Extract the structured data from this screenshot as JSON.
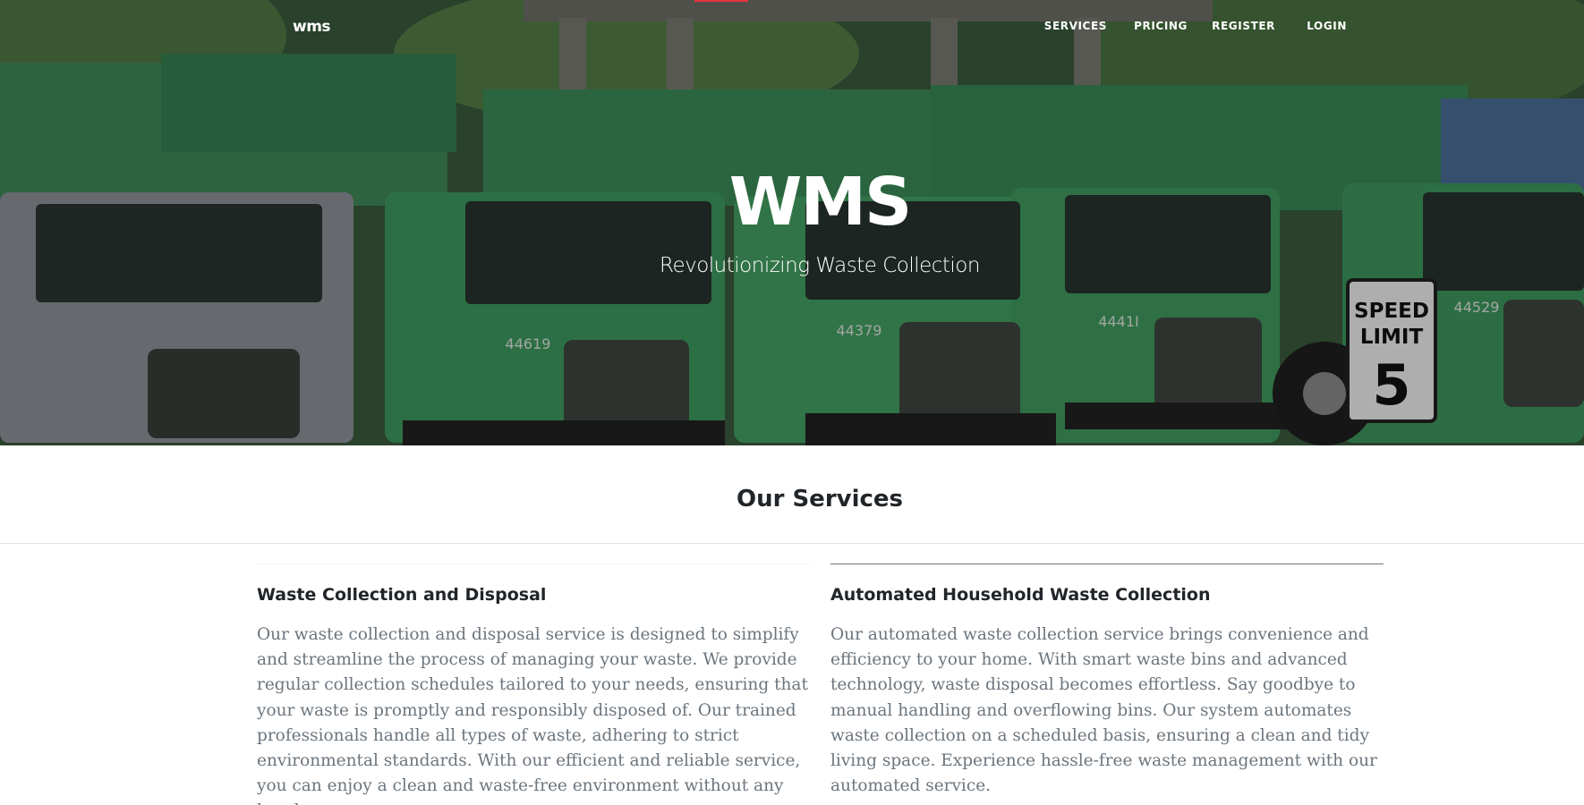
{
  "nav": {
    "brand": "wms",
    "links": [
      "SERVICES",
      "PRICING",
      "REGISTER",
      "LOGIN"
    ]
  },
  "hero": {
    "title": "WMS",
    "subtitle": "Revolutionizing Waste Collection"
  },
  "services": {
    "heading": "Our Services",
    "items": [
      {
        "title": "Waste Collection and Disposal",
        "body": "Our waste collection and disposal service is designed to simplify and streamline the process of managing your waste. We provide regular collection schedules tailored to your needs, ensuring that your waste is promptly and responsibly disposed of. Our trained professionals handle all types of waste, adhering to strict environmental standards. With our efficient and reliable service, you can enjoy a clean and waste-free environment without any hassle."
      },
      {
        "title": "Automated Household Waste Collection",
        "body": "Our automated waste collection service brings convenience and efficiency to your home. With smart waste bins and advanced technology, waste disposal becomes effortless. Say goodbye to manual handling and overflowing bins. Our system automates waste collection on a scheduled basis, ensuring a clean and tidy living space. Experience hassle-free waste management with our automated service."
      }
    ]
  },
  "colors": {
    "accent": "#e8333c",
    "truck_green": "#3d8f5a",
    "text_muted": "#6c757d"
  }
}
